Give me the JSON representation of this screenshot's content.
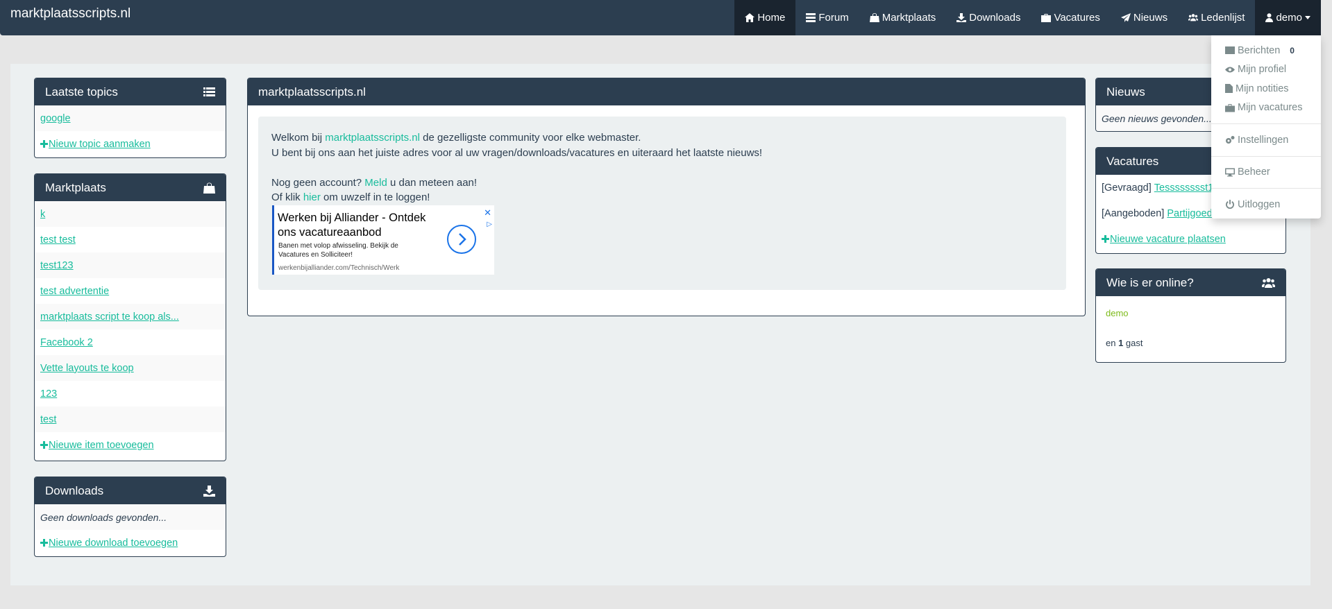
{
  "navbar": {
    "brand": "marktplaatsscripts.nl",
    "items": [
      {
        "icon": "home-icon",
        "label": "Home"
      },
      {
        "icon": "list-icon",
        "label": "Forum"
      },
      {
        "icon": "shopping-bag-icon",
        "label": "Marktplaats"
      },
      {
        "icon": "download-icon",
        "label": "Downloads"
      },
      {
        "icon": "briefcase-icon",
        "label": "Vacatures"
      },
      {
        "icon": "send-icon",
        "label": "Nieuws"
      },
      {
        "icon": "users-icon",
        "label": "Ledenlijst"
      }
    ],
    "user": {
      "icon": "user-icon",
      "label": "demo"
    }
  },
  "user_menu": {
    "berichten": "Berichten",
    "berichten_count": "0",
    "profiel": "Mijn profiel",
    "notities": "Mijn notities",
    "vacatures": "Mijn vacatures",
    "instellingen": "Instellingen",
    "beheer": "Beheer",
    "uitloggen": "Uitloggen"
  },
  "topics": {
    "title": "Laatste topics",
    "items": [
      "google"
    ],
    "add": "Nieuw topic aanmaken"
  },
  "marktplaats": {
    "title": "Marktplaats",
    "items": [
      "k",
      "test test",
      "test123",
      "test advertentie",
      "marktplaats script te koop als...",
      "Facebook 2",
      "Vette layouts te koop",
      "123",
      "test"
    ],
    "add": "Nieuwe item toevoegen"
  },
  "downloads": {
    "title": "Downloads",
    "empty": "Geen downloads gevonden...",
    "add": "Nieuwe download toevoegen"
  },
  "main": {
    "title": "marktplaatsscripts.nl",
    "welcome_pre": "Welkom bij ",
    "welcome_link": "marktplaatsscripts.nl",
    "welcome_post": " de gezelligste community voor elke webmaster.",
    "line2": "U bent bij ons aan het juiste adres voor al uw vragen/downloads/vacatures en uiteraard het laatste nieuws!",
    "account_pre": "Nog geen account? ",
    "account_link": "Meld",
    "account_post": " u dan meteen aan!",
    "login_pre": "Of klik ",
    "login_link": "hier",
    "login_post": " om uwzelf in te loggen!",
    "ad": {
      "title": "Werken bij Alliander - Ontdek ons vacatureaanbod",
      "desc": "Banen met volop afwisseling. Bekijk de Vacatures en Solliciteer!",
      "url": "werkenbijalliander.com/Technisch/Werk"
    }
  },
  "nieuws": {
    "title": "Nieuws",
    "empty": "Geen nieuws gevonden..."
  },
  "vacatures": {
    "title": "Vacatures",
    "items": [
      {
        "type": "[Gevraagd] ",
        "label": "Tesssssssst1"
      },
      {
        "type": "[Aangeboden] ",
        "label": "Partijgoed"
      }
    ],
    "add": "Nieuwe vacature plaatsen"
  },
  "online": {
    "title": "Wie is er online?",
    "user": "demo",
    "guest_pre": "en ",
    "guest_count": "1",
    "guest_post": " gast"
  }
}
